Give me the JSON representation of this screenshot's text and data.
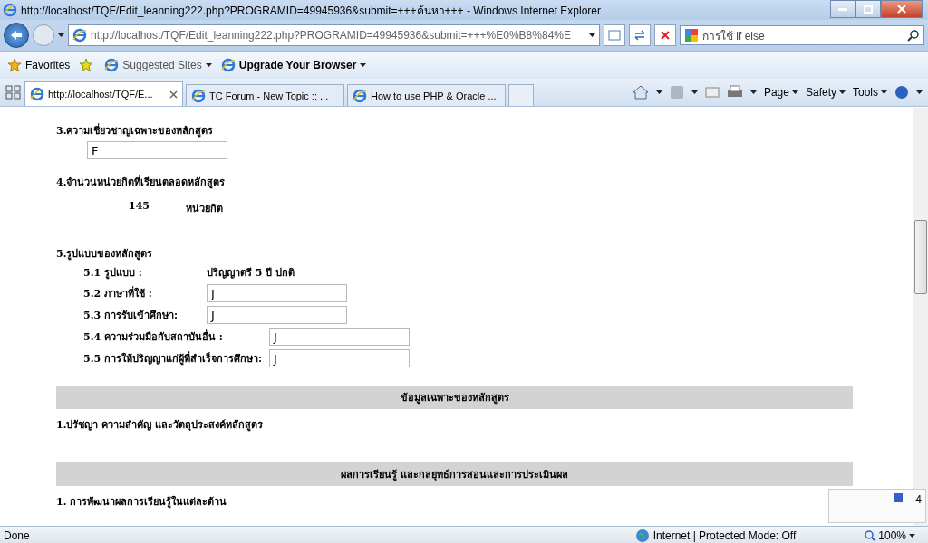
{
  "window": {
    "title": "http://localhost/TQF/Edit_leanning222.php?PROGRAMID=49945936&submit=+++ค้นหา+++ - Windows Internet Explorer"
  },
  "address_bar": {
    "url": "http://localhost/TQF/Edit_leanning222.php?PROGRAMID=49945936&submit=+++%E0%B8%84%E"
  },
  "search": {
    "value": "การใช้ if else"
  },
  "favorites_bar": {
    "favorites": "Favorites",
    "items": [
      {
        "label": "Suggested Sites",
        "bold": false
      },
      {
        "label": "Upgrade Your Browser",
        "bold": true
      }
    ]
  },
  "tabs": [
    {
      "label": "http://localhost/TQF/E...",
      "selected": true
    },
    {
      "label": "TC Forum - New Topic :: ...",
      "selected": false
    },
    {
      "label": "How to use PHP & Oracle ...",
      "selected": false
    }
  ],
  "command_bar": [
    "Page",
    "Safety",
    "Tools"
  ],
  "content": [
    {
      "kind": "heading",
      "text": "3.ความเชี่ยวชาญเฉพาะของหลักสูตร"
    },
    {
      "kind": "field",
      "value": "F"
    },
    {
      "kind": "heading",
      "text": "4.จำนวนหน่วยกิตที่เรียนตลอดหลักสูตร"
    },
    {
      "kind": "amount",
      "value": "145",
      "unit": "หน่วยกิต"
    },
    {
      "kind": "heading",
      "text": "5.รูปแบบของหลักสูตร"
    },
    {
      "kind": "form",
      "rows": [
        {
          "label": "5.1 รูปแบบ :",
          "kind": "text",
          "value": "ปริญญาตรี 5 ปี ปกติ"
        },
        {
          "label": "5.2 ภาษาที่ใช้ :",
          "kind": "field",
          "value": "J"
        },
        {
          "label": "5.3 การรับเข้าศึกษา:",
          "kind": "field",
          "value": "J"
        }
      ]
    },
    {
      "kind": "form",
      "rows": [
        {
          "label": "5.4 ความร่วมมือกับสถาบันอื่น :",
          "kind": "field",
          "value": "J"
        },
        {
          "label": "5.5 การให้ปริญญาแก่ผู้ที่สำเร็จการศึกษา:",
          "kind": "field",
          "value": "J"
        }
      ]
    },
    {
      "kind": "band",
      "text": "ข้อมูลเฉพาะของหลักสูตร"
    },
    {
      "kind": "heading",
      "text": "1.ปรัชญา ความสำคัญ และวัตถุประสงค์หลักสูตร"
    },
    {
      "kind": "band",
      "text": "ผลการเรียนรู้ และกลยุทธ์การสอนและการประเมินผล"
    },
    {
      "kind": "heading",
      "text": "1. การพัฒนาผลการเรียนรู้ในแต่ละด้าน"
    }
  ],
  "language_bar": {
    "text": "4"
  },
  "status_bar": {
    "text": "Done",
    "zone": "Internet | Protected Mode: Off",
    "zoom": "100%"
  }
}
